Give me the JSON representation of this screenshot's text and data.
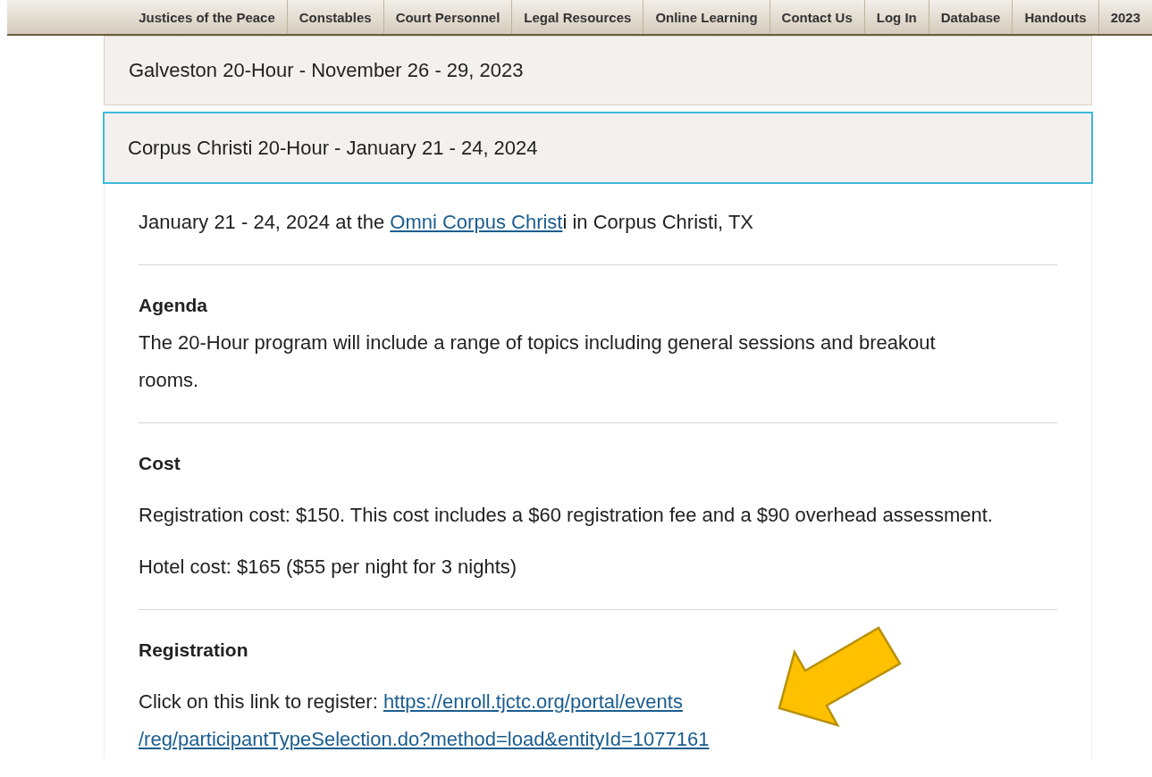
{
  "nav": {
    "items": [
      {
        "label": "Justices of the Peace"
      },
      {
        "label": "Constables"
      },
      {
        "label": "Court Personnel"
      },
      {
        "label": "Legal Resources"
      },
      {
        "label": "Online Learning"
      },
      {
        "label": "Contact Us"
      },
      {
        "label": "Log In"
      },
      {
        "label": "Database"
      },
      {
        "label": "Handouts"
      },
      {
        "label": "2023"
      }
    ]
  },
  "accordion": [
    {
      "title": "Galveston 20-Hour - November 26 - 29, 2023",
      "expanded": false
    },
    {
      "title": "Corpus Christi 20-Hour - January 21 - 24, 2024",
      "expanded": true,
      "intro": {
        "before": "January 21 - 24, 2024 at the ",
        "link": "Omni Corpus Christ",
        "after": "i in Corpus Christi, TX"
      },
      "sections": [
        {
          "heading": "Agenda",
          "kind": "tight",
          "paragraphs": [
            {
              "text": "The 20-Hour program will include a range of topics including general sessions and breakout rooms."
            }
          ]
        },
        {
          "heading": "Cost",
          "kind": "spaced",
          "paragraphs": [
            {
              "text": "Registration cost: $150. This cost includes a $60 registration fee and a $90 overhead assessment."
            },
            {
              "text": "Hotel cost: $165 ($55 per night for 3 nights)"
            }
          ]
        },
        {
          "heading": "Registration",
          "kind": "spaced",
          "paragraphs": [
            {
              "text": "Click on this link to register: ",
              "link_lines": [
                "https://enroll.tjctc.org/portal/events",
                "/reg/participantTypeSelection.do?method=load&entityId=1077161"
              ]
            }
          ]
        }
      ]
    }
  ]
}
